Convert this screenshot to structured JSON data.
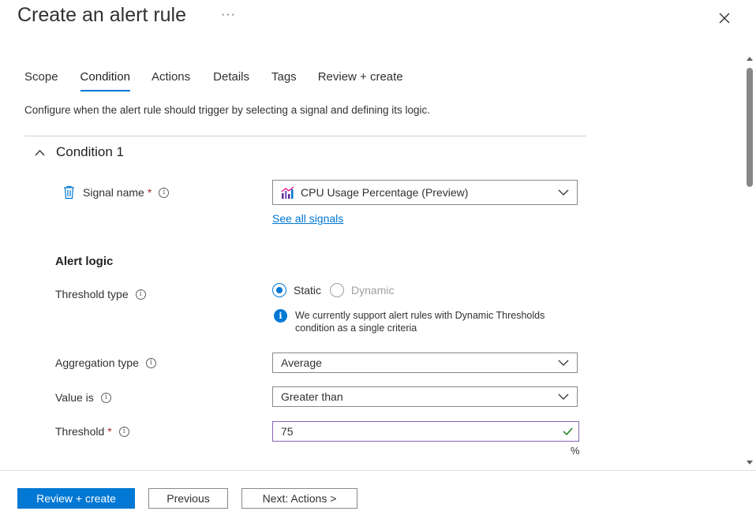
{
  "header": {
    "title": "Create an alert rule",
    "more_label": "···",
    "close_icon": "close-icon"
  },
  "tabs": [
    {
      "label": "Scope",
      "active": false
    },
    {
      "label": "Condition",
      "active": true
    },
    {
      "label": "Actions",
      "active": false
    },
    {
      "label": "Details",
      "active": false
    },
    {
      "label": "Tags",
      "active": false
    },
    {
      "label": "Review + create",
      "active": false
    }
  ],
  "description": "Configure when the alert rule should trigger by selecting a signal and defining its logic.",
  "condition": {
    "title": "Condition 1",
    "signal_label": "Signal name",
    "signal_value": "CPU Usage Percentage (Preview)",
    "see_all_link": "See all signals",
    "required_mark": "*"
  },
  "alert_logic": {
    "title": "Alert logic",
    "threshold_type_label": "Threshold type",
    "static_label": "Static",
    "dynamic_label": "Dynamic",
    "selected": "Static",
    "note": "We currently support alert rules with Dynamic Thresholds condition as a single criteria",
    "aggregation_label": "Aggregation type",
    "aggregation_value": "Average",
    "value_is_label": "Value is",
    "value_is_value": "Greater than",
    "threshold_label": "Threshold",
    "threshold_value": "75",
    "unit": "%"
  },
  "footer": {
    "review_create": "Review + create",
    "previous": "Previous",
    "next": "Next: Actions >"
  },
  "colors": {
    "accent": "#0078d4",
    "required": "#a4262c",
    "valid_border": "#8764b8",
    "valid_check": "#107c10"
  }
}
